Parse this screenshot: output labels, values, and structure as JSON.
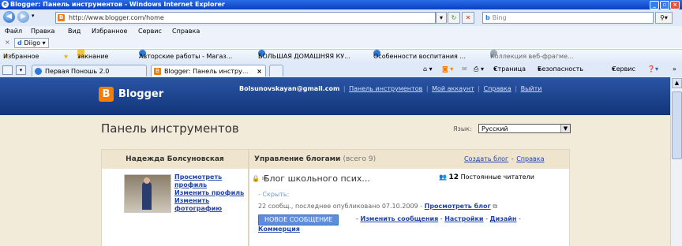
{
  "window": {
    "title": "Blogger: Панель инструментов - Windows Internet Explorer"
  },
  "browser": {
    "url": "http://www.blogger.com/home",
    "search_placeholder": "Bing",
    "menu": [
      "Файл",
      "Правка",
      "Вид",
      "Избранное",
      "Сервис",
      "Справка"
    ],
    "diigo_label": "Diigo",
    "favorites_label": "Избранное",
    "favorites": [
      "закнание",
      "Авторские работы - Магаз...",
      "БОЛЬШАЯ ДОМАШНЯЯ КУ...",
      "Особенности воспитания ...",
      "Коллекция веб-фрагме..."
    ],
    "tabs": [
      {
        "label": "Первая Поношь 2.0",
        "active": false
      },
      {
        "label": "Blogger: Панель инстру...",
        "active": true
      }
    ],
    "command_bar": [
      "Страница",
      "Безопасность",
      "Сервис"
    ]
  },
  "blogger": {
    "logo_text": "Blogger",
    "email": "Bolsunovskayan@gmail.com",
    "top_links": [
      "Панель инструментов",
      "Мой аккаунт",
      "Справка",
      "Выйти"
    ],
    "page_title": "Панель инструментов",
    "language_label": "Язык:",
    "language_value": "Русский",
    "profile": {
      "name": "Надежда Болсуновская",
      "links": [
        "Просмотреть профиль",
        "Изменить профиль",
        "Изменить фотографию"
      ]
    },
    "blogs_panel": {
      "title": "Управление блогами",
      "count": "(всего 9)",
      "create_link": "Создать блог",
      "help_link": "Справка",
      "blog": {
        "name": "Блог школьного псих...",
        "followers_count": "12",
        "followers_label": "Постоянные читатели",
        "hide_label": "- Скрыть:",
        "posted_text": "22 сообщ., последнее опубликовано 07.10.2009 -",
        "view_blog_link": "Просмотреть блог",
        "new_post_button": "НОВОЕ СООБЩЕНИЕ",
        "actions": [
          "Изменить сообщения",
          "Настройки",
          "Дизайн"
        ],
        "commerce_link": "Коммерция"
      }
    }
  }
}
